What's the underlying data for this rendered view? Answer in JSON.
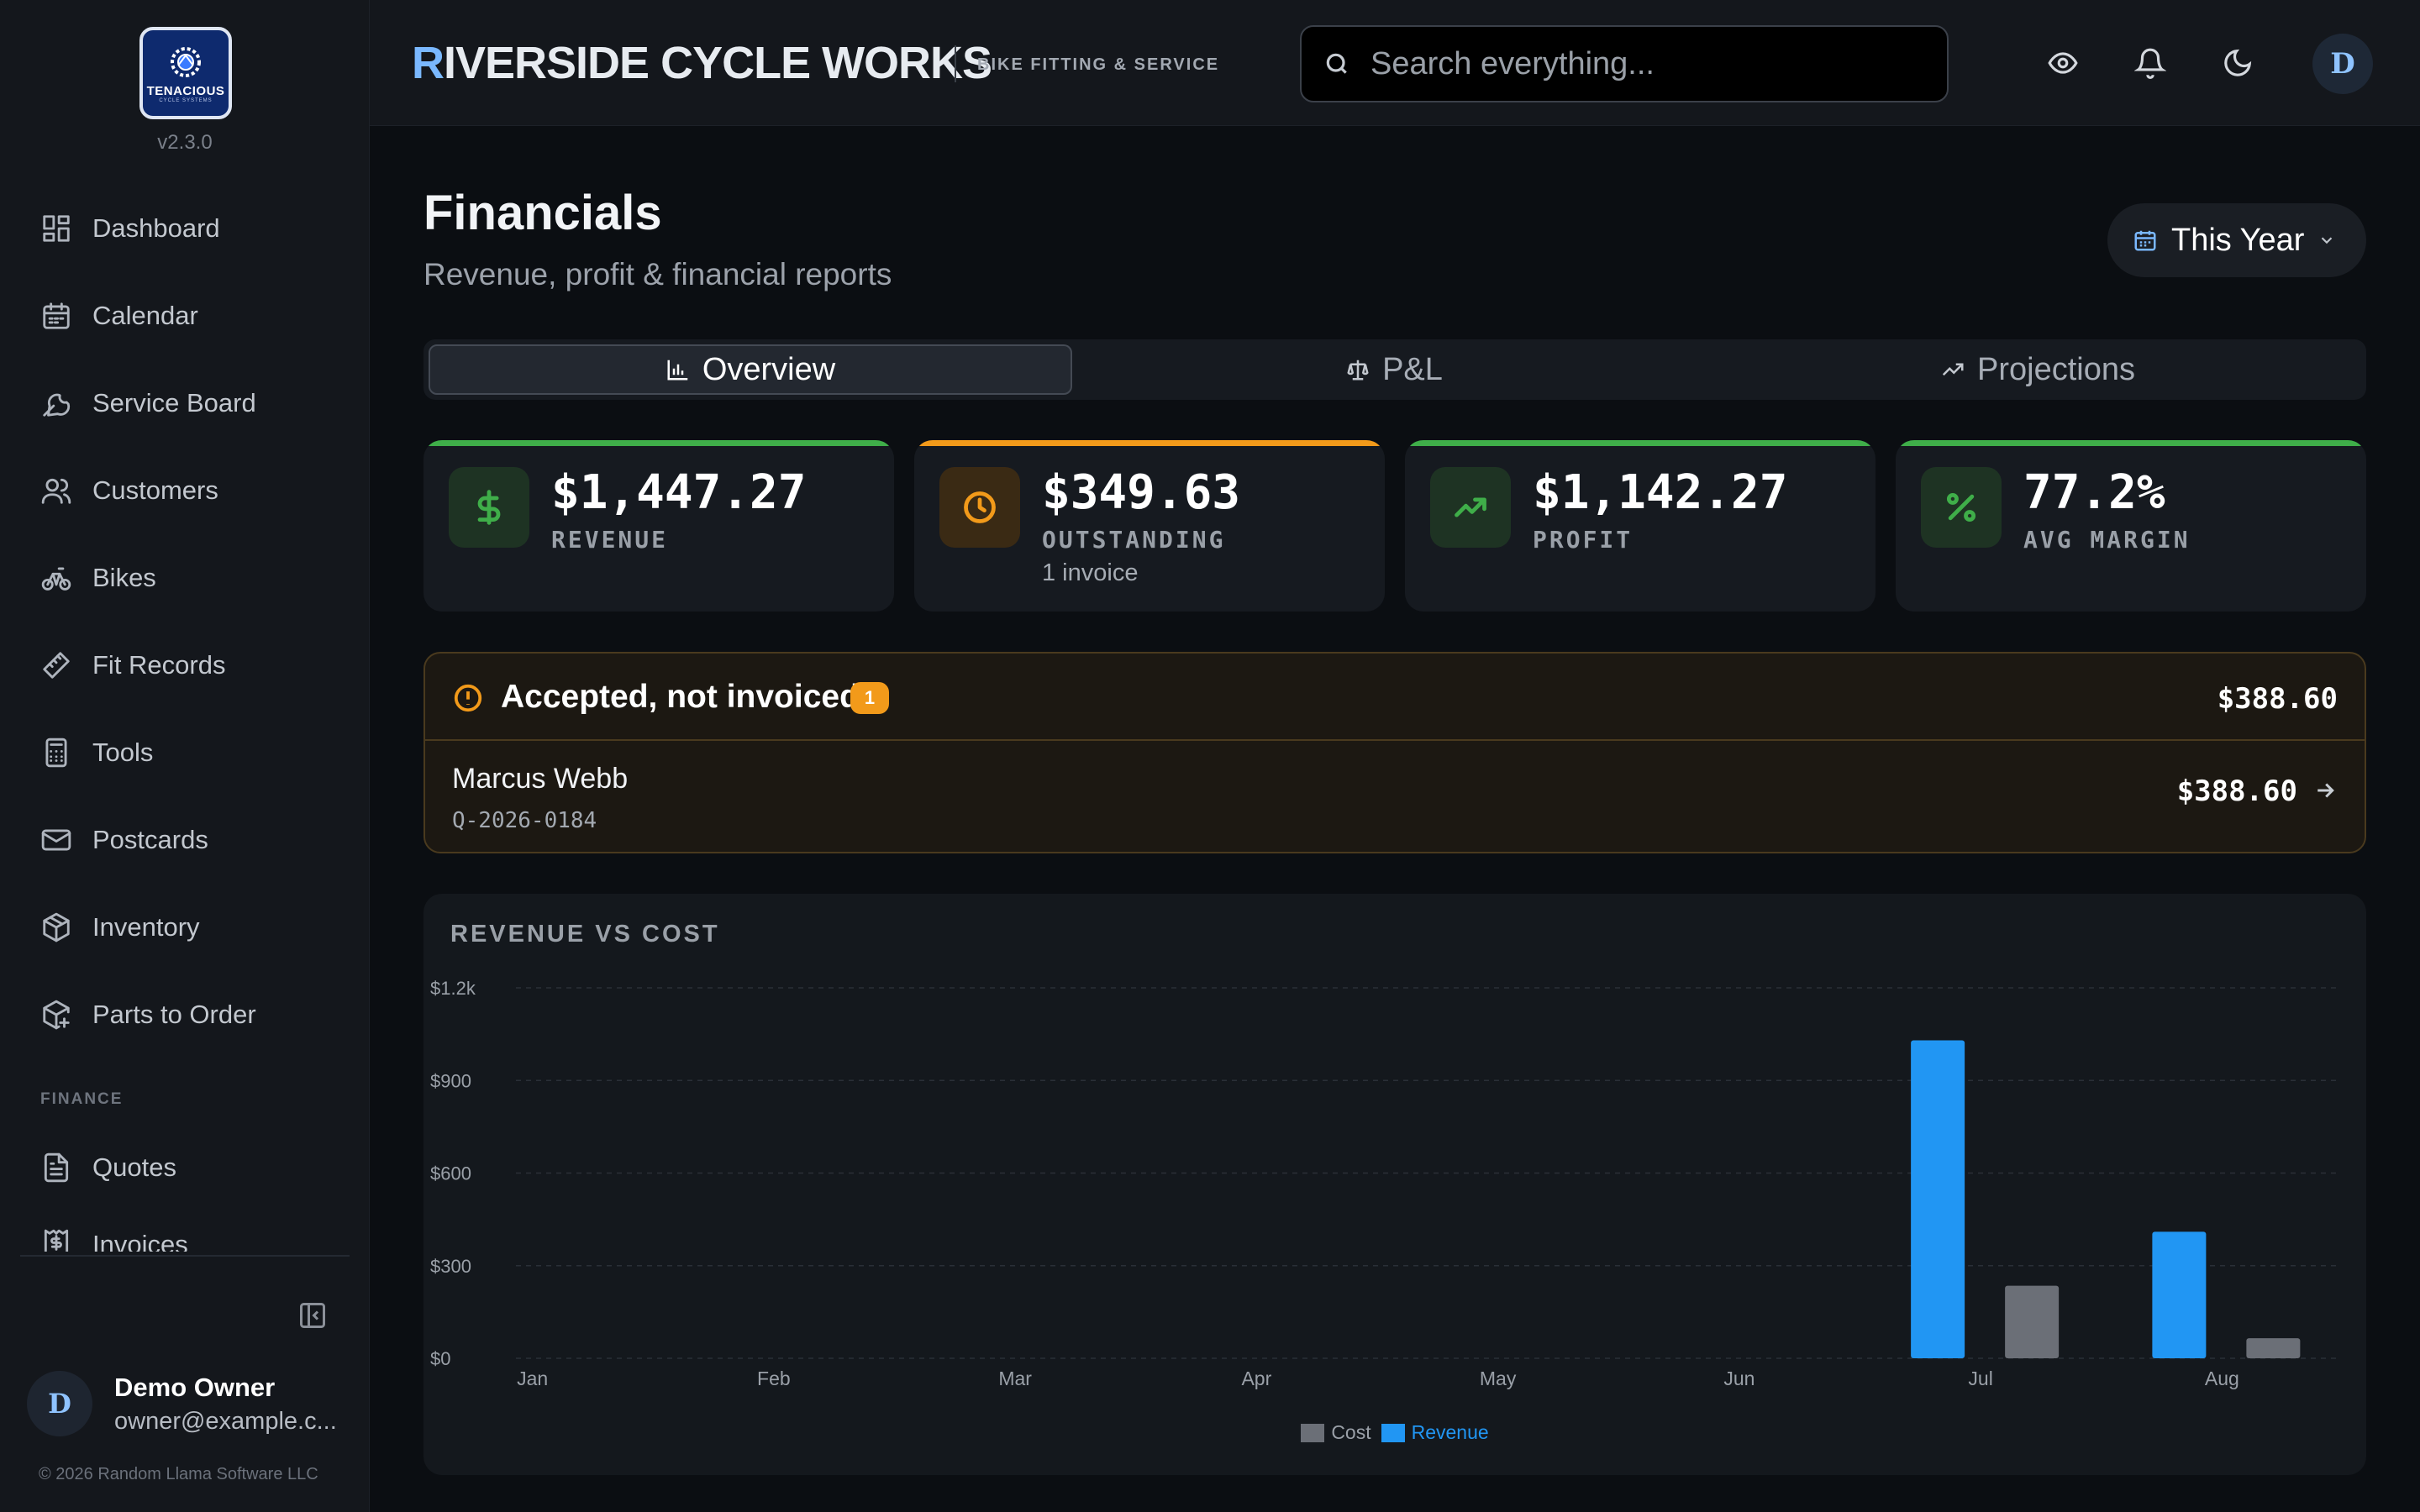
{
  "app": {
    "logo_text": "TENACIOUS",
    "logo_subtext": "CYCLE SYSTEMS",
    "version": "v2.3.0",
    "brand_first": "R",
    "brand_rest": "IVERSIDE CYCLE WORKS",
    "brand_tagline": "BIKE FITTING & SERVICE"
  },
  "search": {
    "placeholder": "Search everything..."
  },
  "topbar": {
    "avatar_initial": "D"
  },
  "sidebar": {
    "items": [
      {
        "label": "Dashboard",
        "icon": "grid-icon"
      },
      {
        "label": "Calendar",
        "icon": "calendar-icon"
      },
      {
        "label": "Service Board",
        "icon": "wrench-icon"
      },
      {
        "label": "Customers",
        "icon": "users-icon"
      },
      {
        "label": "Bikes",
        "icon": "bike-icon"
      },
      {
        "label": "Fit Records",
        "icon": "ruler-icon"
      },
      {
        "label": "Tools",
        "icon": "calculator-icon"
      },
      {
        "label": "Postcards",
        "icon": "mail-icon"
      },
      {
        "label": "Inventory",
        "icon": "package-icon"
      },
      {
        "label": "Parts to Order",
        "icon": "package-plus-icon"
      }
    ],
    "finance_section": "FINANCE",
    "finance_items": [
      {
        "label": "Quotes",
        "icon": "file-text-icon"
      },
      {
        "label": "Invoices",
        "icon": "receipt-icon"
      }
    ],
    "user": {
      "initial": "D",
      "name": "Demo Owner",
      "email": "owner@example.c..."
    },
    "copyright": "© 2026 Random Llama Software LLC"
  },
  "page": {
    "title": "Financials",
    "subtitle": "Revenue, profit & financial reports",
    "period": "This Year"
  },
  "tabs": [
    {
      "label": "Overview",
      "icon": "bar-chart-icon",
      "active": true
    },
    {
      "label": "P&L",
      "icon": "scale-icon",
      "active": false
    },
    {
      "label": "Projections",
      "icon": "trending-up-icon",
      "active": false
    }
  ],
  "kpis": [
    {
      "value": "$1,447.27",
      "label": "REVENUE",
      "note": "",
      "accent": "#3fae49",
      "icon": "dollar-icon"
    },
    {
      "value": "$349.63",
      "label": "OUTSTANDING",
      "note": "1 invoice",
      "accent": "#f29a1a",
      "icon": "clock-icon"
    },
    {
      "value": "$1,142.27",
      "label": "PROFIT",
      "note": "",
      "accent": "#3fae49",
      "icon": "trending-up-icon"
    },
    {
      "value": "77.2%",
      "label": "AVG MARGIN",
      "note": "",
      "accent": "#3fae49",
      "icon": "percent-icon"
    }
  ],
  "alert": {
    "title": "Accepted, not invoiced",
    "count": "1",
    "total": "$388.60",
    "rows": [
      {
        "name": "Marcus Webb",
        "code": "Q-2026-0184",
        "amount": "$388.60"
      }
    ]
  },
  "colors": {
    "accent_blue": "#2196f3",
    "cost_gray": "#6b6f77",
    "success_green": "#3fae49",
    "warning_orange": "#f29a1a"
  },
  "chart_data": {
    "type": "bar",
    "title": "REVENUE VS COST",
    "categories": [
      "Jan",
      "Feb",
      "Mar",
      "Apr",
      "May",
      "Jun",
      "Jul",
      "Aug"
    ],
    "series": [
      {
        "name": "Revenue",
        "color": "#2196f3",
        "values": [
          0,
          0,
          0,
          0,
          0,
          0,
          1030,
          410
        ]
      },
      {
        "name": "Cost",
        "color": "#6b6f77",
        "values": [
          0,
          0,
          0,
          0,
          0,
          0,
          235,
          65
        ]
      }
    ],
    "yticks": [
      "$0",
      "$300",
      "$600",
      "$900",
      "$1.2k"
    ],
    "ytick_values": [
      0,
      300,
      600,
      900,
      1200
    ],
    "ylim": [
      0,
      1200
    ],
    "grid": true,
    "legend": [
      {
        "name": "Cost",
        "color": "#6b6f77"
      },
      {
        "name": "Revenue",
        "color": "#2196f3"
      }
    ],
    "legend_position": "bottom"
  }
}
